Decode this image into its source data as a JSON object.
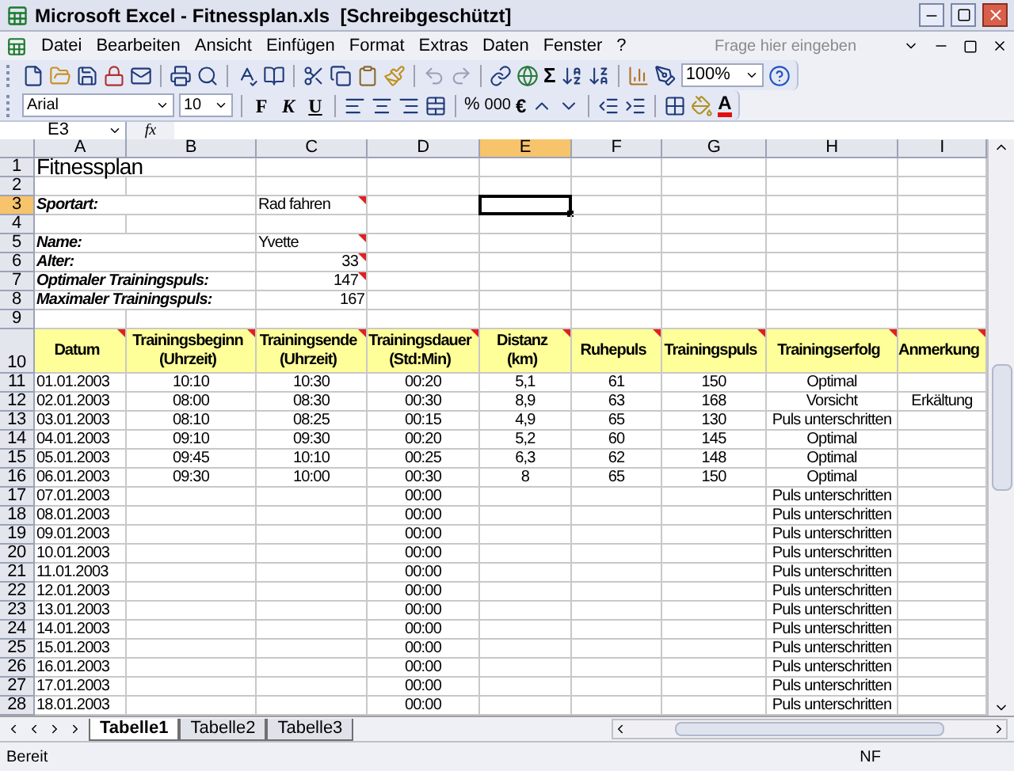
{
  "window": {
    "title": "Microsoft Excel - Fitnessplan.xls  [Schreibgeschützt]"
  },
  "menu": {
    "items": [
      "Datei",
      "Bearbeiten",
      "Ansicht",
      "Einfügen",
      "Format",
      "Extras",
      "Daten",
      "Fenster",
      "?"
    ],
    "help_placeholder": "Frage hier eingeben"
  },
  "standard_toolbar": {
    "sum": "Σ",
    "zoom": "100%"
  },
  "format_toolbar": {
    "font": "Arial",
    "size": "10",
    "bold": "F",
    "italic": "K",
    "underline": "U",
    "percent": "%",
    "thousands": "000",
    "currency": "€",
    "font_color": "A"
  },
  "formula_bar": {
    "name_box": "E3",
    "fx": "fx"
  },
  "sheet": {
    "columns": [
      {
        "label": "A",
        "selected": false
      },
      {
        "label": "B",
        "selected": false
      },
      {
        "label": "C",
        "selected": false
      },
      {
        "label": "D",
        "selected": false
      },
      {
        "label": "E",
        "selected": true
      },
      {
        "label": "F",
        "selected": false
      },
      {
        "label": "G",
        "selected": false
      },
      {
        "label": "H",
        "selected": false
      },
      {
        "label": "I",
        "selected": false
      }
    ],
    "rows": [
      {
        "number": "1",
        "selected": false,
        "kind": "title",
        "cells": [
          {
            "text": "Fitnessplan",
            "comment": false
          },
          {
            "comment": false
          },
          {
            "comment": false
          },
          {
            "comment": false
          },
          {
            "comment": false
          },
          {
            "comment": false
          },
          {
            "comment": false
          },
          {
            "comment": false
          },
          {
            "comment": false
          }
        ]
      },
      {
        "number": "2",
        "selected": false,
        "kind": "data",
        "cells": [
          {
            "comment": false
          },
          {
            "comment": false
          },
          {
            "comment": false
          },
          {
            "comment": false
          },
          {
            "comment": false
          },
          {
            "comment": false
          },
          {
            "comment": false
          },
          {
            "comment": false
          },
          {
            "comment": false
          }
        ]
      },
      {
        "number": "3",
        "selected": true,
        "kind": "label",
        "cells": [
          {
            "text": "Sportart:",
            "comment": false
          },
          {
            "comment": false
          },
          {
            "text": "Rad fahren",
            "comment": true
          },
          {
            "comment": false
          },
          {
            "comment": false
          },
          {
            "comment": false
          },
          {
            "comment": false
          },
          {
            "comment": false
          },
          {
            "comment": false
          }
        ]
      },
      {
        "number": "4",
        "selected": false,
        "kind": "data",
        "cells": [
          {
            "comment": false
          },
          {
            "comment": false
          },
          {
            "comment": false
          },
          {
            "comment": false
          },
          {
            "comment": false
          },
          {
            "comment": false
          },
          {
            "comment": false
          },
          {
            "comment": false
          },
          {
            "comment": false
          }
        ]
      },
      {
        "number": "5",
        "selected": false,
        "kind": "label",
        "cells": [
          {
            "text": "Name:",
            "comment": false
          },
          {
            "comment": false
          },
          {
            "text": "Yvette",
            "comment": true
          },
          {
            "comment": false
          },
          {
            "comment": false
          },
          {
            "comment": false
          },
          {
            "comment": false
          },
          {
            "comment": false
          },
          {
            "comment": false
          }
        ]
      },
      {
        "number": "6",
        "selected": false,
        "kind": "metric",
        "cells": [
          {
            "text": "Alter:",
            "comment": false
          },
          {
            "comment": false
          },
          {
            "text": "33",
            "comment": true
          },
          {
            "comment": false
          },
          {
            "comment": false
          },
          {
            "comment": false
          },
          {
            "comment": false
          },
          {
            "comment": false
          },
          {
            "comment": false
          }
        ]
      },
      {
        "number": "7",
        "selected": false,
        "kind": "metric",
        "cells": [
          {
            "text": "Optimaler Trainingspuls:",
            "comment": false
          },
          {
            "comment": false
          },
          {
            "text": "147",
            "comment": true
          },
          {
            "comment": false
          },
          {
            "comment": false
          },
          {
            "comment": false
          },
          {
            "comment": false
          },
          {
            "comment": false
          },
          {
            "comment": false
          }
        ]
      },
      {
        "number": "8",
        "selected": false,
        "kind": "metric",
        "cells": [
          {
            "text": "Maximaler Trainingspuls:",
            "comment": false
          },
          {
            "comment": false
          },
          {
            "text": "167",
            "comment": false
          },
          {
            "comment": false
          },
          {
            "comment": false
          },
          {
            "comment": false
          },
          {
            "comment": false
          },
          {
            "comment": false
          },
          {
            "comment": false
          }
        ]
      },
      {
        "number": "9",
        "selected": false,
        "kind": "data",
        "cells": [
          {
            "comment": false
          },
          {
            "comment": false
          },
          {
            "comment": false
          },
          {
            "comment": false
          },
          {
            "comment": false
          },
          {
            "comment": false
          },
          {
            "comment": false
          },
          {
            "comment": false
          },
          {
            "comment": false
          }
        ]
      },
      {
        "number": "10",
        "selected": false,
        "kind": "header",
        "cells": [
          {
            "text": "Datum",
            "comment": true
          },
          {
            "text": "Trainingsbeginn\n(Uhrzeit)",
            "comment": true
          },
          {
            "text": "Trainingsende\n(Uhrzeit)",
            "comment": true
          },
          {
            "text": "Trainingsdauer\n(Std:Min)",
            "comment": true
          },
          {
            "text": "Distanz\n(km)",
            "comment": true
          },
          {
            "text": "Ruhepuls",
            "comment": true
          },
          {
            "text": "Trainingspuls",
            "comment": true
          },
          {
            "text": "Trainingserfolg",
            "comment": true
          },
          {
            "text": "Anmerkung",
            "comment": true
          }
        ]
      },
      {
        "number": "11",
        "selected": false,
        "kind": "data",
        "cells": [
          {
            "text": "01.01.2003",
            "comment": false
          },
          {
            "text": "10:10",
            "comment": false
          },
          {
            "text": "10:30",
            "comment": false
          },
          {
            "text": "00:20",
            "comment": false
          },
          {
            "text": "5,1",
            "comment": false
          },
          {
            "text": "61",
            "comment": false
          },
          {
            "text": "150",
            "comment": false
          },
          {
            "text": "Optimal",
            "comment": false
          },
          {
            "comment": false
          }
        ]
      },
      {
        "number": "12",
        "selected": false,
        "kind": "data",
        "cells": [
          {
            "text": "02.01.2003",
            "comment": false
          },
          {
            "text": "08:00",
            "comment": false
          },
          {
            "text": "08:30",
            "comment": false
          },
          {
            "text": "00:30",
            "comment": false
          },
          {
            "text": "8,9",
            "comment": false
          },
          {
            "text": "63",
            "comment": false
          },
          {
            "text": "168",
            "comment": false
          },
          {
            "text": "Vorsicht",
            "comment": false
          },
          {
            "text": "Erkältung",
            "comment": false
          }
        ]
      },
      {
        "number": "13",
        "selected": false,
        "kind": "data",
        "cells": [
          {
            "text": "03.01.2003",
            "comment": false
          },
          {
            "text": "08:10",
            "comment": false
          },
          {
            "text": "08:25",
            "comment": false
          },
          {
            "text": "00:15",
            "comment": false
          },
          {
            "text": "4,9",
            "comment": false
          },
          {
            "text": "65",
            "comment": false
          },
          {
            "text": "130",
            "comment": false
          },
          {
            "text": "Puls unterschritten",
            "comment": false
          },
          {
            "comment": false
          }
        ]
      },
      {
        "number": "14",
        "selected": false,
        "kind": "data",
        "cells": [
          {
            "text": "04.01.2003",
            "comment": false
          },
          {
            "text": "09:10",
            "comment": false
          },
          {
            "text": "09:30",
            "comment": false
          },
          {
            "text": "00:20",
            "comment": false
          },
          {
            "text": "5,2",
            "comment": false
          },
          {
            "text": "60",
            "comment": false
          },
          {
            "text": "145",
            "comment": false
          },
          {
            "text": "Optimal",
            "comment": false
          },
          {
            "comment": false
          }
        ]
      },
      {
        "number": "15",
        "selected": false,
        "kind": "data",
        "cells": [
          {
            "text": "05.01.2003",
            "comment": false
          },
          {
            "text": "09:45",
            "comment": false
          },
          {
            "text": "10:10",
            "comment": false
          },
          {
            "text": "00:25",
            "comment": false
          },
          {
            "text": "6,3",
            "comment": false
          },
          {
            "text": "62",
            "comment": false
          },
          {
            "text": "148",
            "comment": false
          },
          {
            "text": "Optimal",
            "comment": false
          },
          {
            "comment": false
          }
        ]
      },
      {
        "number": "16",
        "selected": false,
        "kind": "data",
        "cells": [
          {
            "text": "06.01.2003",
            "comment": false
          },
          {
            "text": "09:30",
            "comment": false
          },
          {
            "text": "10:00",
            "comment": false
          },
          {
            "text": "00:30",
            "comment": false
          },
          {
            "text": "8",
            "comment": false
          },
          {
            "text": "65",
            "comment": false
          },
          {
            "text": "150",
            "comment": false
          },
          {
            "text": "Optimal",
            "comment": false
          },
          {
            "comment": false
          }
        ]
      },
      {
        "number": "17",
        "selected": false,
        "kind": "data",
        "cells": [
          {
            "text": "07.01.2003",
            "comment": false
          },
          {
            "comment": false
          },
          {
            "comment": false
          },
          {
            "text": "00:00",
            "comment": false
          },
          {
            "comment": false
          },
          {
            "comment": false
          },
          {
            "comment": false
          },
          {
            "text": "Puls unterschritten",
            "comment": false
          },
          {
            "comment": false
          }
        ]
      },
      {
        "number": "18",
        "selected": false,
        "kind": "data",
        "cells": [
          {
            "text": "08.01.2003",
            "comment": false
          },
          {
            "comment": false
          },
          {
            "comment": false
          },
          {
            "text": "00:00",
            "comment": false
          },
          {
            "comment": false
          },
          {
            "comment": false
          },
          {
            "comment": false
          },
          {
            "text": "Puls unterschritten",
            "comment": false
          },
          {
            "comment": false
          }
        ]
      },
      {
        "number": "19",
        "selected": false,
        "kind": "data",
        "cells": [
          {
            "text": "09.01.2003",
            "comment": false
          },
          {
            "comment": false
          },
          {
            "comment": false
          },
          {
            "text": "00:00",
            "comment": false
          },
          {
            "comment": false
          },
          {
            "comment": false
          },
          {
            "comment": false
          },
          {
            "text": "Puls unterschritten",
            "comment": false
          },
          {
            "comment": false
          }
        ]
      },
      {
        "number": "20",
        "selected": false,
        "kind": "data",
        "cells": [
          {
            "text": "10.01.2003",
            "comment": false
          },
          {
            "comment": false
          },
          {
            "comment": false
          },
          {
            "text": "00:00",
            "comment": false
          },
          {
            "comment": false
          },
          {
            "comment": false
          },
          {
            "comment": false
          },
          {
            "text": "Puls unterschritten",
            "comment": false
          },
          {
            "comment": false
          }
        ]
      },
      {
        "number": "21",
        "selected": false,
        "kind": "data",
        "cells": [
          {
            "text": "11.01.2003",
            "comment": false
          },
          {
            "comment": false
          },
          {
            "comment": false
          },
          {
            "text": "00:00",
            "comment": false
          },
          {
            "comment": false
          },
          {
            "comment": false
          },
          {
            "comment": false
          },
          {
            "text": "Puls unterschritten",
            "comment": false
          },
          {
            "comment": false
          }
        ]
      },
      {
        "number": "22",
        "selected": false,
        "kind": "data",
        "cells": [
          {
            "text": "12.01.2003",
            "comment": false
          },
          {
            "comment": false
          },
          {
            "comment": false
          },
          {
            "text": "00:00",
            "comment": false
          },
          {
            "comment": false
          },
          {
            "comment": false
          },
          {
            "comment": false
          },
          {
            "text": "Puls unterschritten",
            "comment": false
          },
          {
            "comment": false
          }
        ]
      },
      {
        "number": "23",
        "selected": false,
        "kind": "data",
        "cells": [
          {
            "text": "13.01.2003",
            "comment": false
          },
          {
            "comment": false
          },
          {
            "comment": false
          },
          {
            "text": "00:00",
            "comment": false
          },
          {
            "comment": false
          },
          {
            "comment": false
          },
          {
            "comment": false
          },
          {
            "text": "Puls unterschritten",
            "comment": false
          },
          {
            "comment": false
          }
        ]
      },
      {
        "number": "24",
        "selected": false,
        "kind": "data",
        "cells": [
          {
            "text": "14.01.2003",
            "comment": false
          },
          {
            "comment": false
          },
          {
            "comment": false
          },
          {
            "text": "00:00",
            "comment": false
          },
          {
            "comment": false
          },
          {
            "comment": false
          },
          {
            "comment": false
          },
          {
            "text": "Puls unterschritten",
            "comment": false
          },
          {
            "comment": false
          }
        ]
      },
      {
        "number": "25",
        "selected": false,
        "kind": "data",
        "cells": [
          {
            "text": "15.01.2003",
            "comment": false
          },
          {
            "comment": false
          },
          {
            "comment": false
          },
          {
            "text": "00:00",
            "comment": false
          },
          {
            "comment": false
          },
          {
            "comment": false
          },
          {
            "comment": false
          },
          {
            "text": "Puls unterschritten",
            "comment": false
          },
          {
            "comment": false
          }
        ]
      },
      {
        "number": "26",
        "selected": false,
        "kind": "data",
        "cells": [
          {
            "text": "16.01.2003",
            "comment": false
          },
          {
            "comment": false
          },
          {
            "comment": false
          },
          {
            "text": "00:00",
            "comment": false
          },
          {
            "comment": false
          },
          {
            "comment": false
          },
          {
            "comment": false
          },
          {
            "text": "Puls unterschritten",
            "comment": false
          },
          {
            "comment": false
          }
        ]
      },
      {
        "number": "27",
        "selected": false,
        "kind": "data",
        "cells": [
          {
            "text": "17.01.2003",
            "comment": false
          },
          {
            "comment": false
          },
          {
            "comment": false
          },
          {
            "text": "00:00",
            "comment": false
          },
          {
            "comment": false
          },
          {
            "comment": false
          },
          {
            "comment": false
          },
          {
            "text": "Puls unterschritten",
            "comment": false
          },
          {
            "comment": false
          }
        ]
      },
      {
        "number": "28",
        "selected": false,
        "kind": "data",
        "cells": [
          {
            "text": "18.01.2003",
            "comment": false
          },
          {
            "comment": false
          },
          {
            "comment": false
          },
          {
            "text": "00:00",
            "comment": false
          },
          {
            "comment": false
          },
          {
            "comment": false
          },
          {
            "comment": false
          },
          {
            "text": "Puls unterschritten",
            "comment": false
          },
          {
            "comment": false
          }
        ]
      }
    ]
  },
  "sheet_tabs": [
    {
      "label": "Tabelle1",
      "selected": true
    },
    {
      "label": "Tabelle2",
      "selected": false
    },
    {
      "label": "Tabelle3",
      "selected": false
    }
  ],
  "status_bar": {
    "status": "Bereit",
    "indicator": "NF"
  }
}
